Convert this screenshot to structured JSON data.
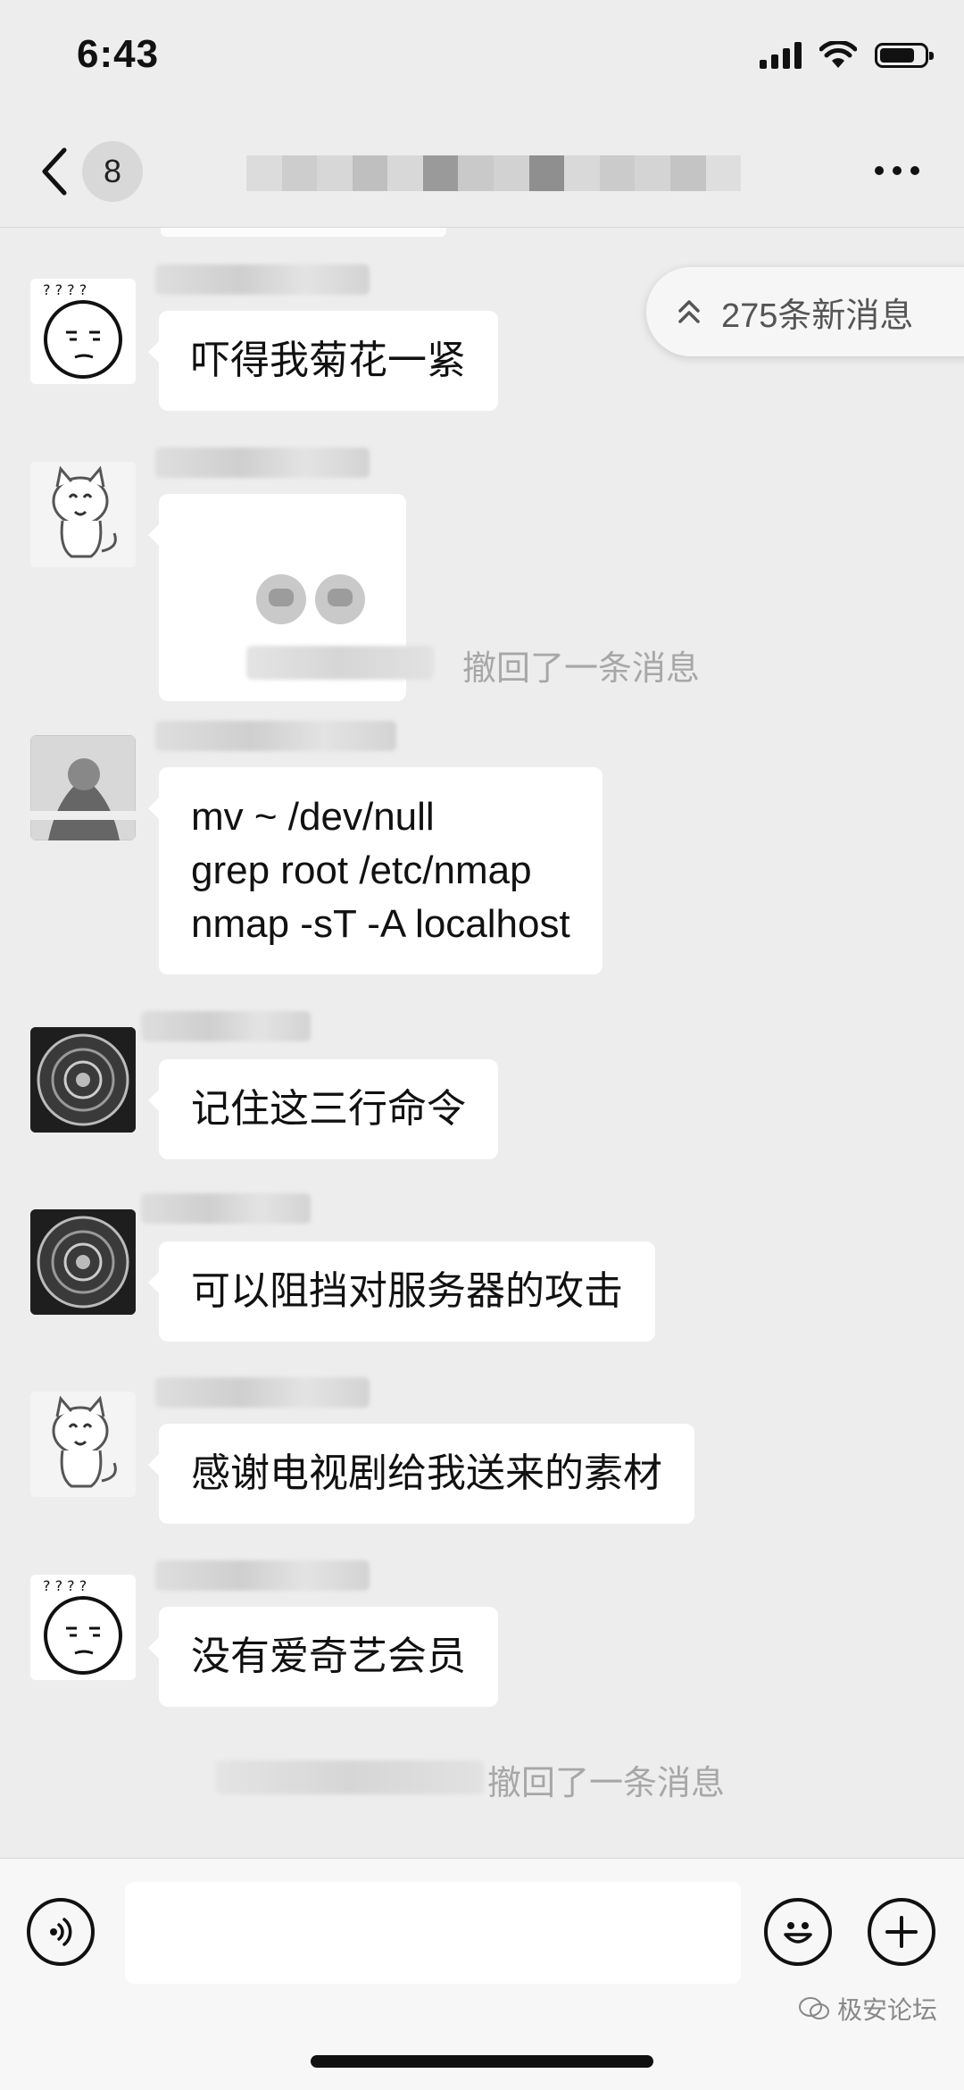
{
  "status_bar": {
    "time": "6:43"
  },
  "nav": {
    "back_count": "8"
  },
  "new_messages": {
    "label": "275条新消息"
  },
  "messages": [
    {
      "text": "吓得我菊花一紧"
    },
    {
      "text": ""
    },
    {
      "recall": "撤回了一条消息"
    },
    {
      "text": "mv ~ /dev/null\ngrep root /etc/nmap\nnmap -sT -A localhost"
    },
    {
      "text": "记住这三行命令"
    },
    {
      "text": "可以阻挡对服务器的攻击"
    },
    {
      "text": "感谢电视剧给我送来的素材"
    },
    {
      "text": "没有爱奇艺会员"
    },
    {
      "recall": "撤回了一条消息"
    }
  ],
  "watermark": {
    "text": "极安论坛"
  },
  "icons": {
    "signal": "cellular-signal-icon",
    "wifi": "wifi-icon",
    "battery": "battery-icon",
    "back": "chevron-left-icon",
    "more": "more-dots-icon",
    "voice": "voice-icon",
    "emoji": "emoji-icon",
    "add": "plus-icon",
    "chevrons": "double-chevron-up-icon"
  },
  "colors": {
    "background": "#ededed",
    "bubble": "#ffffff",
    "recall_text": "#a7a7a7"
  }
}
